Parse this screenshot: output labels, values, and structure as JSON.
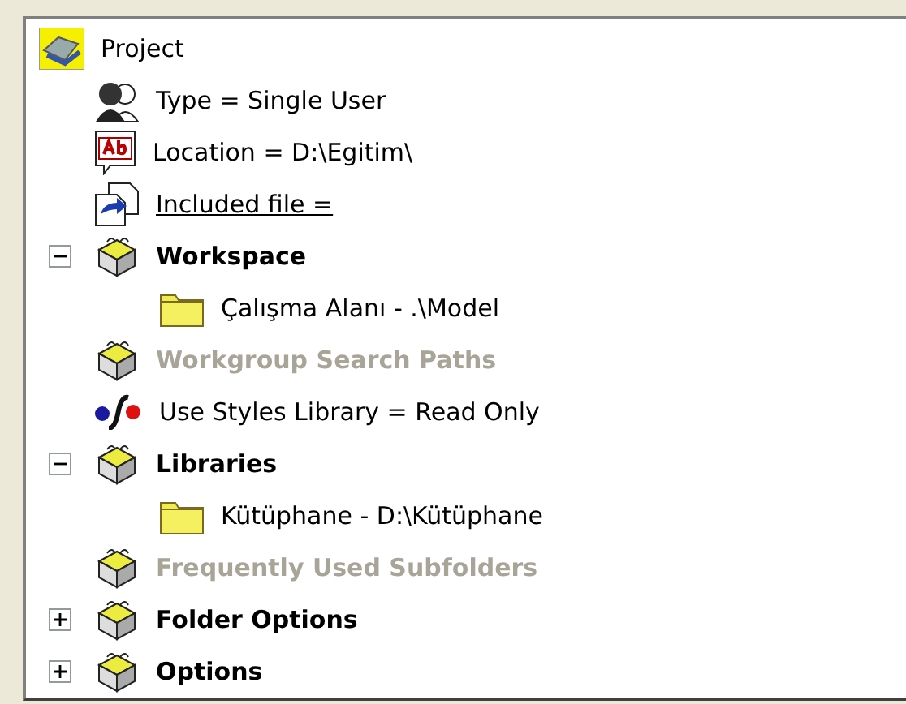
{
  "tree": {
    "label": "Project",
    "kind": "project",
    "children": [
      {
        "label": "Type = Single User",
        "kind": "users",
        "bold": false,
        "disabled": false,
        "underlined": false
      },
      {
        "label": "Location = D:\\Egitim\\",
        "kind": "text",
        "bold": false,
        "disabled": false,
        "underlined": false
      },
      {
        "label": "Included file =",
        "kind": "link",
        "bold": false,
        "disabled": false,
        "underlined": true
      },
      {
        "label": "Workspace",
        "kind": "package",
        "bold": true,
        "disabled": false,
        "underlined": false,
        "expanded": true,
        "children": [
          {
            "label": "Çalışma Alanı - .\\Model",
            "kind": "folder",
            "bold": false,
            "disabled": false,
            "underlined": false
          }
        ]
      },
      {
        "label": "Workgroup Search Paths",
        "kind": "package",
        "bold": true,
        "disabled": true,
        "underlined": false
      },
      {
        "label": "Use Styles Library = Read Only",
        "kind": "styles",
        "bold": false,
        "disabled": false,
        "underlined": false
      },
      {
        "label": "Libraries",
        "kind": "package",
        "bold": true,
        "disabled": false,
        "underlined": false,
        "expanded": true,
        "children": [
          {
            "label": "Kütüphane - D:\\Kütüphane",
            "kind": "folder",
            "bold": false,
            "disabled": false,
            "underlined": false
          }
        ]
      },
      {
        "label": "Frequently Used Subfolders",
        "kind": "package",
        "bold": true,
        "disabled": true,
        "underlined": false
      },
      {
        "label": "Folder Options",
        "kind": "package",
        "bold": true,
        "disabled": false,
        "underlined": false,
        "expanded": false
      },
      {
        "label": "Options",
        "kind": "package",
        "bold": true,
        "disabled": false,
        "underlined": false,
        "expanded": false
      }
    ]
  }
}
